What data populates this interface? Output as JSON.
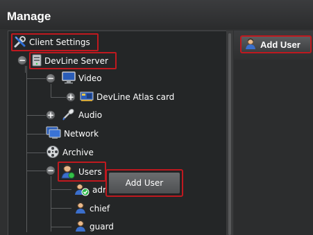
{
  "window": {
    "title": "Manage"
  },
  "tree": {
    "client_settings": "Client Settings",
    "server": "DevLine Server",
    "video": "Video",
    "capture_card": "DevLine Atlas card",
    "audio": "Audio",
    "network": "Network",
    "archive": "Archive",
    "users": "Users",
    "user_admin": "adr",
    "user_chief": "chief",
    "user_guard": "guard"
  },
  "context_menu": {
    "add_user": "Add User"
  },
  "toolbar": {
    "add_user_label": "Add User"
  },
  "colors": {
    "highlight": "#c0191f",
    "background": "#2f3031",
    "panel": "#242627"
  }
}
